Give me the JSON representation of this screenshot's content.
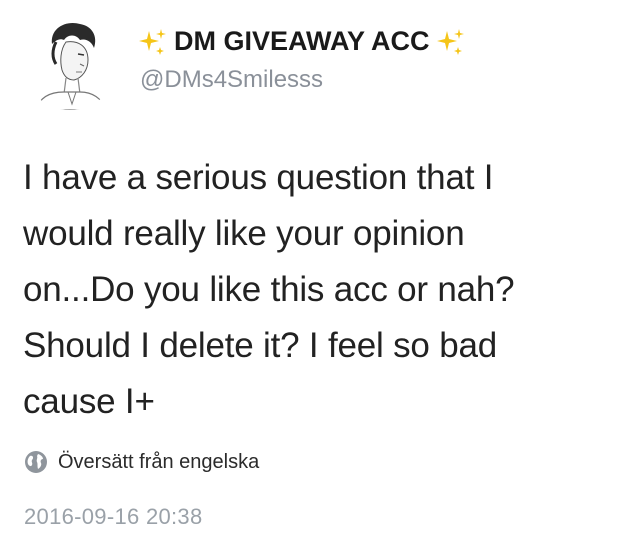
{
  "user": {
    "display_name": "DM GIVEAWAY ACC",
    "handle": "@DMs4Smilesss",
    "avatar_icon": "sketch-portrait-avatar",
    "name_decoration_icon": "sparkles-icon"
  },
  "tweet": {
    "text": "I have a serious question that I\nwould really like your opinion\non...Do you like this acc or nah?\nShould I delete it? I feel so bad\ncause I+",
    "translate_label": "Översätt från engelska",
    "translate_icon": "globe-icon",
    "timestamp": "2016-09-16 20:38"
  },
  "colors": {
    "name": "#1a1a1a",
    "handle": "#8a9099",
    "body_text": "#222222",
    "timestamp": "#9aa1a8",
    "sparkle": "#f5c518"
  }
}
